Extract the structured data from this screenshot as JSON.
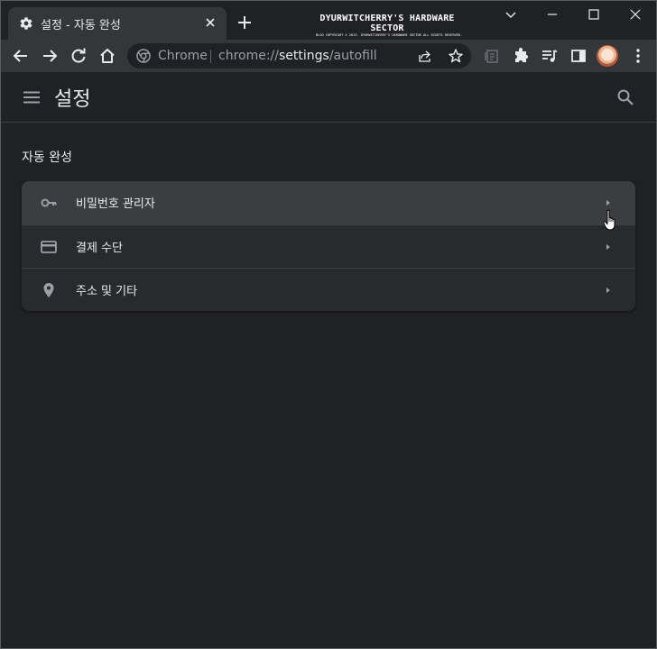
{
  "tab": {
    "title": "설정 - 자동 완성"
  },
  "watermark": {
    "title": "DYURWITCHERRY'S HARDWARE SECTOR",
    "subtitle": "BLOG COPYRIGHT © 2013. DYURWITCHERRY'S HARDWARE SECTOR ALL RIGHTS RESERVED."
  },
  "omnibox": {
    "scheme_label": "Chrome",
    "url_prefix": "chrome://",
    "url_host": "settings",
    "url_path": "/autofill"
  },
  "header": {
    "title": "설정"
  },
  "section": {
    "title": "자동 완성"
  },
  "items": [
    {
      "label": "비밀번호 관리자",
      "icon": "key-icon"
    },
    {
      "label": "결제 수단",
      "icon": "credit-card-icon"
    },
    {
      "label": "주소 및 기타",
      "icon": "location-pin-icon"
    }
  ],
  "colors": {
    "background": "#202124",
    "toolbar": "#35363a",
    "card": "#292a2d",
    "hover": "#3c3d40",
    "text": "#e8eaed",
    "icon": "#9aa0a6"
  }
}
